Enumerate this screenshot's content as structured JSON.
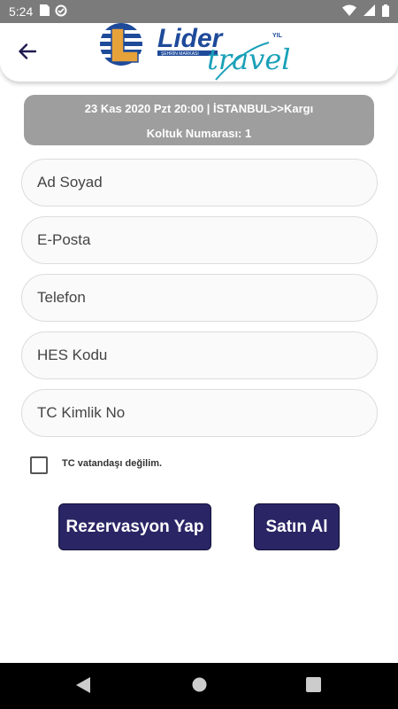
{
  "status": {
    "time": "5:24"
  },
  "trip": {
    "summary": "23 Kas 2020 Pzt 20:00 | İSTANBUL>>Kargı",
    "seat": "Koltuk Numarası: 1"
  },
  "logo": {
    "brand": "Lider",
    "script": "travel",
    "tagline": "ŞEHRİN MARKASI",
    "year": "YIL"
  },
  "form": {
    "name_placeholder": "Ad Soyad",
    "email_placeholder": "E-Posta",
    "phone_placeholder": "Telefon",
    "hes_placeholder": "HES Kodu",
    "tc_placeholder": "TC Kimlik No",
    "not_citizen_label": "TC vatandaşı değilim."
  },
  "actions": {
    "reserve_label": "Rezervasyon Yap",
    "buy_label": "Satın Al"
  },
  "colors": {
    "primary_button": "#2a2565",
    "info_bg": "#9e9e9e",
    "logo_blue": "#1e4a9a",
    "logo_orange": "#e8a23a",
    "logo_teal": "#1aa1b8"
  }
}
